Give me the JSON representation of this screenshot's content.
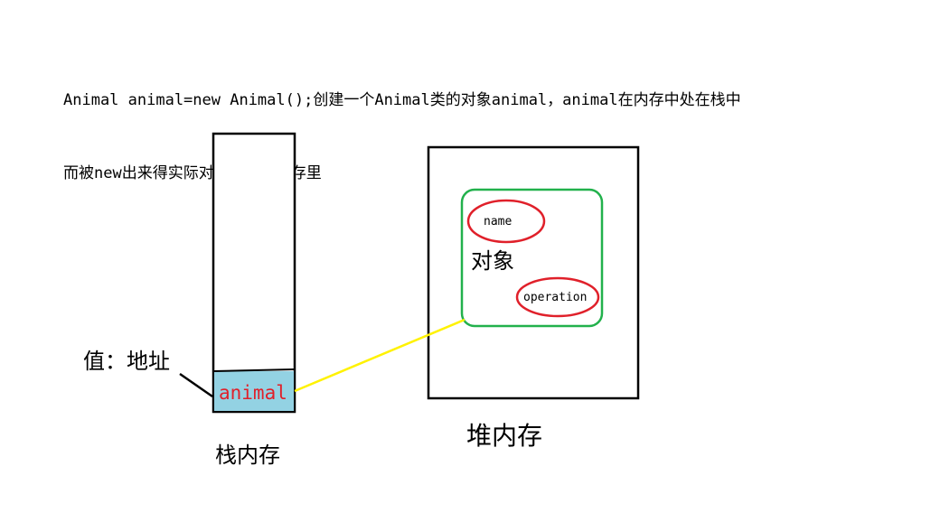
{
  "caption": {
    "line1": "Animal animal=new Animal();创建一个Animal类的对象animal，animal在内存中处在栈中",
    "line2": "而被new出来得实际对象放在堆内存里"
  },
  "stack": {
    "label": "栈内存",
    "slot_text": "animal",
    "slot_color": "#93D2E3",
    "value_label": "值：地址"
  },
  "heap": {
    "label": "堆内存",
    "object_label": "对象",
    "field_1": "name",
    "field_2": "operation",
    "object_border_color": "#22B14C",
    "field_border_color": "#E0202A"
  },
  "pointer": {
    "color": "#FFF200"
  }
}
